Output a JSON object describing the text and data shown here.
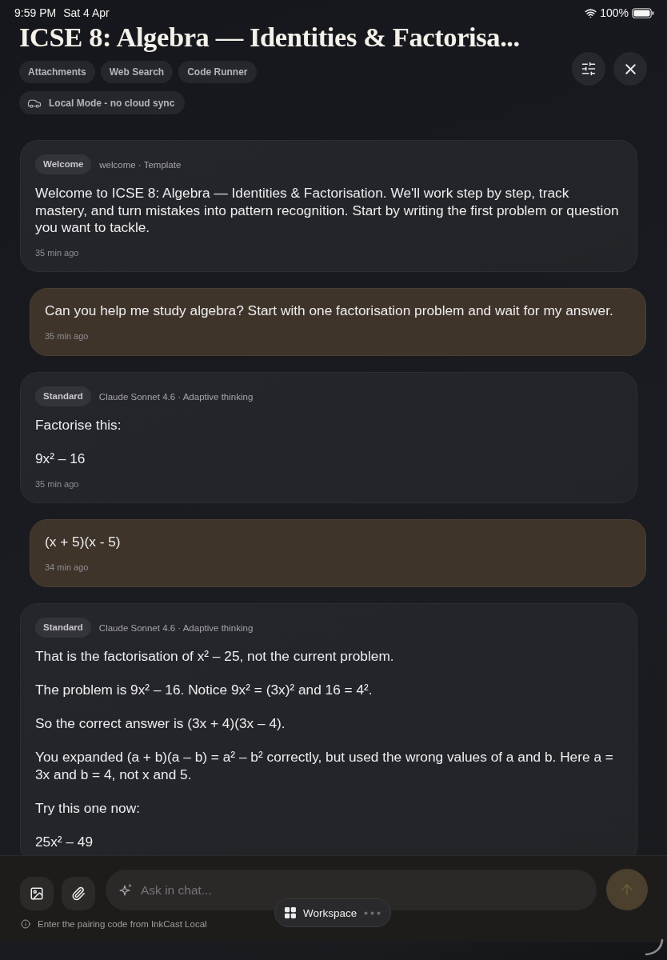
{
  "status_bar": {
    "time": "9:59 PM",
    "date": "Sat 4 Apr",
    "battery": "100%"
  },
  "header": {
    "title": "ICSE 8: Algebra — Identities & Factorisa...",
    "tools": [
      "Attachments",
      "Web Search",
      "Code Runner"
    ],
    "mode": "Local Mode - no cloud sync"
  },
  "messages": [
    {
      "kind": "assistant",
      "badge": "Welcome",
      "meta": "welcome · Template",
      "paragraphs": [
        "Welcome to ICSE 8: Algebra — Identities & Factorisation. We'll work step by step, track mastery, and turn mistakes into pattern recognition. Start by writing the first problem or question you want to tackle."
      ],
      "time": "35 min ago"
    },
    {
      "kind": "user",
      "paragraphs": [
        "Can you help me study algebra? Start with one factorisation problem and wait for my answer."
      ],
      "time": "35 min ago"
    },
    {
      "kind": "assistant",
      "badge": "Standard",
      "meta": "Claude Sonnet 4.6 · Adaptive thinking",
      "paragraphs": [
        "Factorise this:",
        "9x² – 16"
      ],
      "time": "35 min ago"
    },
    {
      "kind": "user",
      "paragraphs": [
        "(x + 5)(x - 5)"
      ],
      "time": "34 min ago"
    },
    {
      "kind": "assistant",
      "badge": "Standard",
      "meta": "Claude Sonnet 4.6 · Adaptive thinking",
      "paragraphs": [
        "That is the factorisation of x² – 25, not the current problem.",
        "The problem is 9x² – 16. Notice 9x² = (3x)² and 16 = 4².",
        "So the correct answer is (3x + 4)(3x – 4).",
        "You expanded (a + b)(a – b) = a² – b² correctly, but used the wrong values of a and b. Here a = 3x and b = 4, not x and 5.",
        "Try this one now:",
        "25x² – 49"
      ]
    }
  ],
  "composer": {
    "placeholder": "Ask in chat...",
    "send": {
      "disabled": true
    },
    "hint": "Enter the pairing code from InkCast Local"
  },
  "workspace": {
    "label": "Workspace"
  }
}
